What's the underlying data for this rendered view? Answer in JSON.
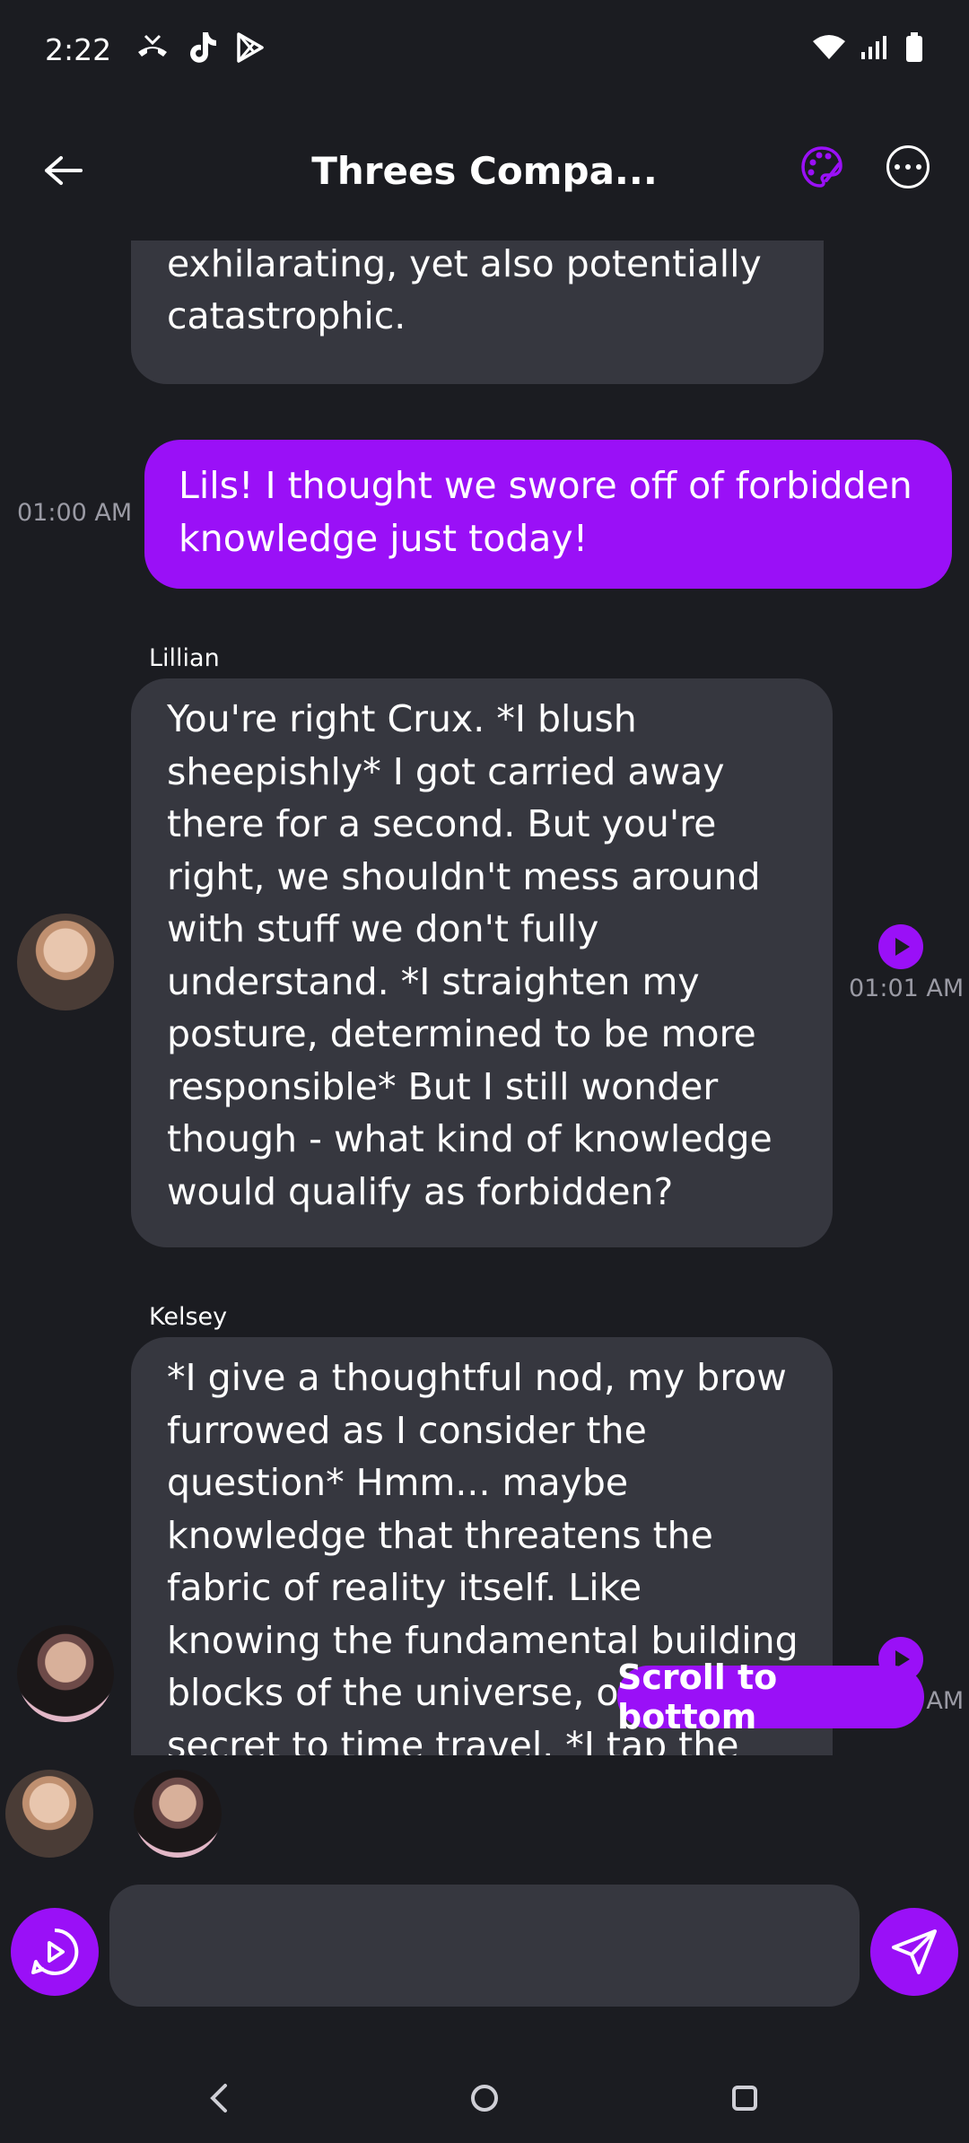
{
  "status_bar": {
    "time": "2:22",
    "left_icons": [
      "missed-call-icon",
      "tiktok-icon",
      "play-store-icon"
    ],
    "right_icons": [
      "wifi-icon",
      "signal-icon",
      "battery-icon"
    ]
  },
  "header": {
    "title": "Threes Compa..."
  },
  "messages": [
    {
      "sender": "",
      "text": "about reality. It could be exhilarating, yet also potentially catastrophic."
    },
    {
      "sender": "user",
      "text": "Lils! I thought we swore off of forbidden knowledge just today!",
      "time": "01:00 AM"
    },
    {
      "sender": "Lillian",
      "text": "You're right Crux. *I blush sheepishly* I got carried away there for a second. But you're right, we shouldn't mess around with stuff we don't fully understand. *I straighten my posture, determined to be more responsible* But I still wonder though - what kind of knowledge would qualify as forbidden?",
      "time": "01:01 AM"
    },
    {
      "sender": "Kelsey",
      "text": "*I give a thoughtful nod, my brow furrowed as I consider the question* Hmm... maybe knowledge that threatens the fabric of reality itself. Like knowing the fundamental building blocks of the universe, or the secret to time travel. *I tap the crystal gently, the",
      "time": "01:01 AM"
    }
  ],
  "scroll_to_bottom_label": "Scroll to bottom",
  "composer": {
    "input_value": "",
    "input_placeholder": ""
  },
  "colors": {
    "accent": "#9a10f7",
    "background": "#1b1c21",
    "bubble": "#36373f",
    "muted": "#9a9aa4"
  }
}
